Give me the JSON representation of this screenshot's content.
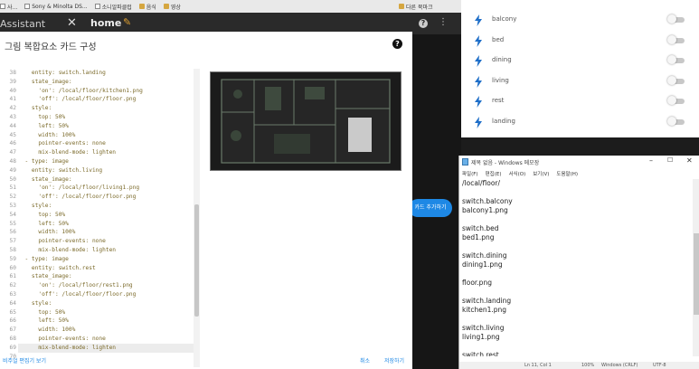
{
  "browser": {
    "bookmarks": [
      {
        "icon": "page-icon",
        "label": "사..."
      },
      {
        "icon": "page-icon",
        "label": "Sony & Minolta DS..."
      },
      {
        "icon": "page-icon",
        "label": "소니알파클럽"
      },
      {
        "icon": "folder-icon",
        "label": "음식"
      },
      {
        "icon": "folder-icon",
        "label": "영상"
      }
    ],
    "other_bookmarks": "다른 북마크"
  },
  "ha_header": {
    "sidebar_title": "Assistant",
    "view_name": "home",
    "help_glyph": "?",
    "menu_glyph": "⋮",
    "fab_label": "카드 추가하기"
  },
  "dialog": {
    "title": "그림 복합요소 카드 구성",
    "help_glyph": "?",
    "code_lines": [
      {
        "n": "38",
        "text": "    entity: switch.landing"
      },
      {
        "n": "39",
        "text": "    state_image:"
      },
      {
        "n": "40",
        "text": "      'on': /local/floor/kitchen1.png"
      },
      {
        "n": "41",
        "text": "      'off': /local/floor/floor.png"
      },
      {
        "n": "42",
        "text": "    style:"
      },
      {
        "n": "43",
        "text": "      top: 50%"
      },
      {
        "n": "44",
        "text": "      left: 50%"
      },
      {
        "n": "45",
        "text": "      width: 100%"
      },
      {
        "n": "46",
        "text": "      pointer-events: none"
      },
      {
        "n": "47",
        "text": "      mix-blend-mode: lighten"
      },
      {
        "n": "48",
        "text": "  - type: image"
      },
      {
        "n": "49",
        "text": "    entity: switch.living"
      },
      {
        "n": "50",
        "text": "    state_image:"
      },
      {
        "n": "51",
        "text": "      'on': /local/floor/living1.png"
      },
      {
        "n": "52",
        "text": "      'off': /local/floor/floor.png"
      },
      {
        "n": "53",
        "text": "    style:"
      },
      {
        "n": "54",
        "text": "      top: 50%"
      },
      {
        "n": "55",
        "text": "      left: 50%"
      },
      {
        "n": "56",
        "text": "      width: 100%"
      },
      {
        "n": "57",
        "text": "      pointer-events: none"
      },
      {
        "n": "58",
        "text": "      mix-blend-mode: lighten"
      },
      {
        "n": "59",
        "text": "  - type: image"
      },
      {
        "n": "60",
        "text": "    entity: switch.rest"
      },
      {
        "n": "61",
        "text": "    state_image:"
      },
      {
        "n": "62",
        "text": "      'on': /local/floor/rest1.png"
      },
      {
        "n": "63",
        "text": "      'off': /local/floor/floor.png"
      },
      {
        "n": "64",
        "text": "    style:"
      },
      {
        "n": "65",
        "text": "      top: 50%"
      },
      {
        "n": "66",
        "text": "      left: 50%"
      },
      {
        "n": "67",
        "text": "      width: 100%"
      },
      {
        "n": "68",
        "text": "      pointer-events: none"
      },
      {
        "n": "69",
        "text": "      mix-blend-mode: lighten"
      },
      {
        "n": "70",
        "text": ""
      }
    ],
    "highlighted_line": "69",
    "footer": {
      "visual_editor": "비주얼 편집기 보기",
      "cancel": "취소",
      "save": "저장하기"
    }
  },
  "toggles": [
    {
      "name": "balcony",
      "on": false
    },
    {
      "name": "bed",
      "on": false
    },
    {
      "name": "dining",
      "on": false
    },
    {
      "name": "living",
      "on": false
    },
    {
      "name": "rest",
      "on": false
    },
    {
      "name": "landing",
      "on": false
    }
  ],
  "notepad": {
    "title": "제목 없음 - Windows 메모장",
    "menu": [
      "파일(F)",
      "편집(E)",
      "서식(O)",
      "보기(V)",
      "도움말(H)"
    ],
    "lines": [
      "/local/floor/",
      "",
      "switch.balcony",
      "balcony1.png",
      "",
      "switch.bed",
      "bed1.png",
      "",
      "switch.dining",
      "dining1.png",
      "",
      "floor.png",
      "",
      "switch.landing",
      "kitchen1.png",
      "",
      "switch.living",
      "living1.png",
      "",
      "switch.rest"
    ],
    "status": {
      "position": "Ln 11, Col 1",
      "zoom": "100%",
      "line_ending": "Windows (CRLF)",
      "encoding": "UTF-8"
    }
  },
  "colors": {
    "accent": "#1e88e5",
    "bolt": "#1e6ec8"
  }
}
